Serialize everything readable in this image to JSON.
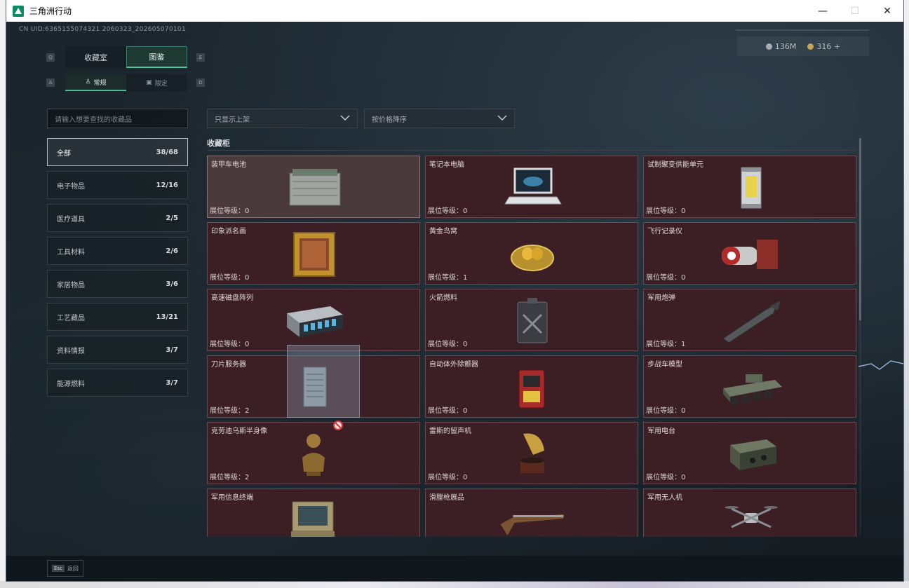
{
  "window": {
    "title": "三角洲行动",
    "minimize": "—",
    "maximize": "☐",
    "close": "✕"
  },
  "uid": "CN UID:6365155074321 2060323_202605070101",
  "currency": {
    "silver": "136M",
    "gold": "316 +"
  },
  "key_hints": {
    "q": "Q",
    "e": "E",
    "a": "A",
    "d": "D"
  },
  "main_tabs": [
    {
      "label": "收藏室"
    },
    {
      "label": "图鉴"
    }
  ],
  "sub_tabs": [
    {
      "label": "常规"
    },
    {
      "label": "限定"
    }
  ],
  "search": {
    "placeholder": "请输入想要查找的收藏品"
  },
  "filters": {
    "shelf": "只显示上架",
    "sort": "按价格降序"
  },
  "categories": [
    {
      "label": "全部",
      "count": "38/68"
    },
    {
      "label": "电子物品",
      "count": "12/16"
    },
    {
      "label": "医疗道具",
      "count": "2/5"
    },
    {
      "label": "工具材料",
      "count": "2/6"
    },
    {
      "label": "家居物品",
      "count": "3/6"
    },
    {
      "label": "工艺藏品",
      "count": "13/21"
    },
    {
      "label": "资料情报",
      "count": "3/7"
    },
    {
      "label": "能源燃料",
      "count": "3/7"
    }
  ],
  "section_title": "收藏柜",
  "items": [
    {
      "name": "装甲车电池",
      "level": "展位等级：0",
      "icon": "battery-icon"
    },
    {
      "name": "笔记本电脑",
      "level": "展位等级：0",
      "icon": "laptop-icon"
    },
    {
      "name": "试制聚变供能单元",
      "level": "展位等级：0",
      "icon": "fusion-cell-icon"
    },
    {
      "name": "印象派名画",
      "level": "展位等级：0",
      "icon": "painting-icon"
    },
    {
      "name": "黄金鸟窝",
      "level": "展位等级：1",
      "icon": "golden-nest-icon"
    },
    {
      "name": "飞行记录仪",
      "level": "展位等级：0",
      "icon": "flight-recorder-icon"
    },
    {
      "name": "高速磁盘阵列",
      "level": "展位等级：0",
      "icon": "disk-array-icon"
    },
    {
      "name": "火箭燃料",
      "level": "展位等级：0",
      "icon": "fuel-can-icon"
    },
    {
      "name": "军用炮弹",
      "level": "展位等级：1",
      "icon": "artillery-shell-icon"
    },
    {
      "name": "刀片服务器",
      "level": "展位等级：2",
      "icon": "blade-server-icon"
    },
    {
      "name": "自动体外除颤器",
      "level": "展位等级：0",
      "icon": "defibrillator-icon"
    },
    {
      "name": "步战车模型",
      "level": "展位等级：0",
      "icon": "ifv-model-icon"
    },
    {
      "name": "克劳迪乌斯半身像",
      "level": "展位等级：2",
      "icon": "bust-icon"
    },
    {
      "name": "雷斯的留声机",
      "level": "展位等级：0",
      "icon": "gramophone-icon"
    },
    {
      "name": "军用电台",
      "level": "展位等级：0",
      "icon": "radio-icon"
    },
    {
      "name": "军用信息终端",
      "level": "",
      "icon": "terminal-icon"
    },
    {
      "name": "滑膛枪展品",
      "level": "",
      "icon": "musket-icon"
    },
    {
      "name": "军用无人机",
      "level": "",
      "icon": "drone-icon"
    }
  ],
  "footer": {
    "esc_key": "Esc",
    "back_label": "返回"
  },
  "colors": {
    "accent": "#58c5a2",
    "card_bg": "#3b1f24",
    "card_border": "#6a4a4f"
  }
}
